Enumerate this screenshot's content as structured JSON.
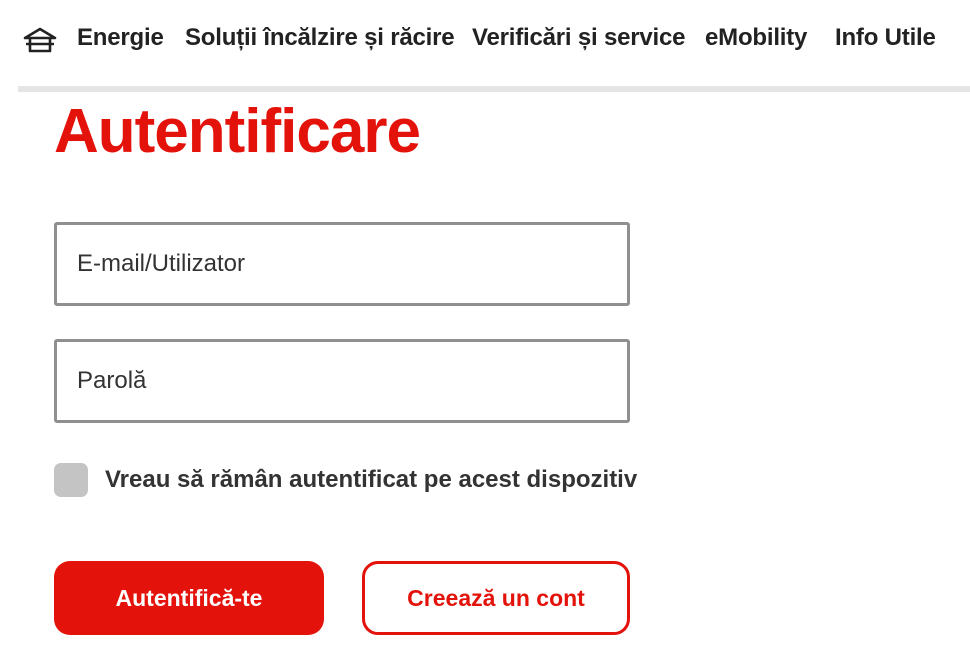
{
  "nav": {
    "home_icon": "home-icon",
    "items": [
      {
        "label": "Energie"
      },
      {
        "label": "Soluții încălzire și răcire"
      },
      {
        "label": "Verificări și service"
      },
      {
        "label": "eMobility"
      },
      {
        "label": "Info Utile"
      }
    ]
  },
  "page": {
    "title": "Autentificare"
  },
  "form": {
    "email_placeholder": "E-mail/Utilizator",
    "email_value": "",
    "password_placeholder": "Parolă",
    "password_value": "",
    "remember_label": "Vreau să rămân autentificat pe acest dispozitiv",
    "remember_checked": false,
    "login_button": "Autentifică-te",
    "create_account_button": "Creează un cont"
  },
  "colors": {
    "brand_red": "#e3120b",
    "text_dark": "#222222",
    "field_border": "#8f8f8f",
    "checkbox_gray": "#c4c4c4",
    "divider_gray": "#e5e5e5"
  }
}
